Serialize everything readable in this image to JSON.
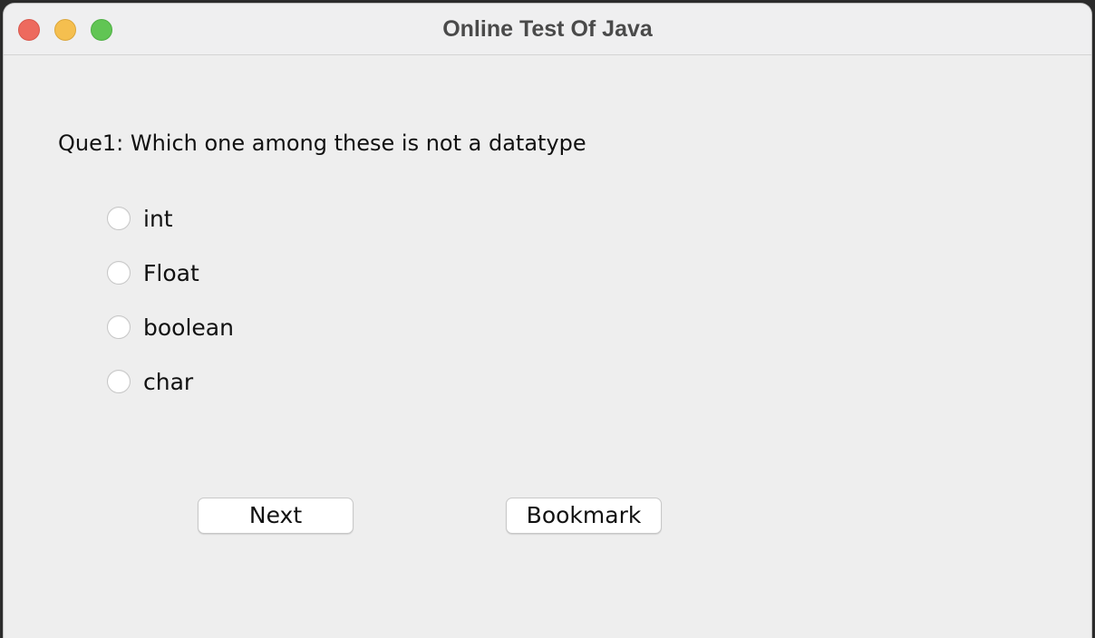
{
  "window": {
    "title": "Online Test Of Java",
    "controls": {
      "close_color": "#ed6a5e",
      "minimize_color": "#f5bf4f",
      "zoom_color": "#61c554"
    }
  },
  "quiz": {
    "question": "Que1: Which one among these is not a datatype",
    "options": [
      {
        "label": "int",
        "selected": false
      },
      {
        "label": "Float",
        "selected": false
      },
      {
        "label": "boolean",
        "selected": false
      },
      {
        "label": "char",
        "selected": false
      }
    ]
  },
  "buttons": {
    "next_label": "Next",
    "bookmark_label": "Bookmark"
  }
}
